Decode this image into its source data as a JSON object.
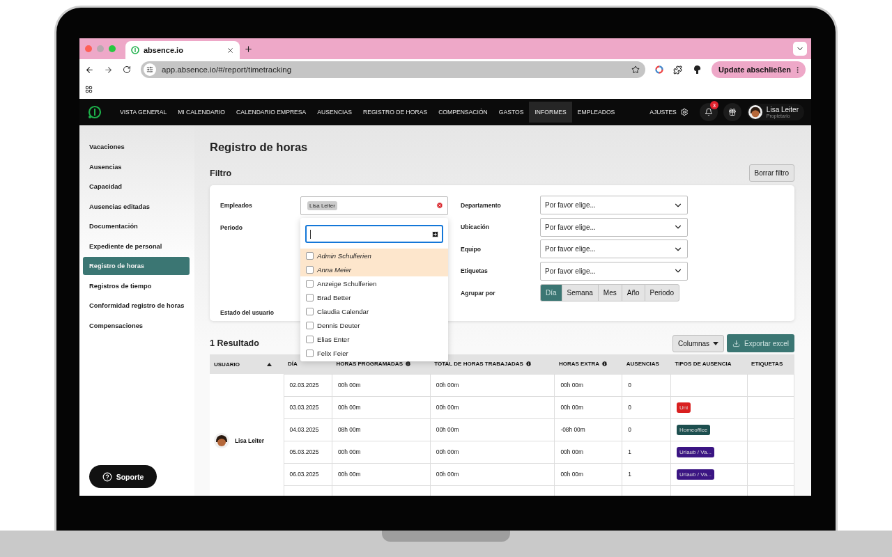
{
  "browser": {
    "tab": {
      "title": "absence.io"
    },
    "url": "app.absence.io/#/report/timetracking",
    "update_button": "Update abschließen"
  },
  "nav": {
    "items": [
      {
        "label": "VISTA GENERAL",
        "selected": false
      },
      {
        "label": "MI CALENDARIO",
        "selected": false
      },
      {
        "label": "CALENDARIO EMPRESA",
        "selected": false
      },
      {
        "label": "AUSENCIAS",
        "selected": false
      },
      {
        "label": "REGISTRO DE HORAS",
        "selected": false
      },
      {
        "label": "COMPENSACIÓN",
        "selected": false
      },
      {
        "label": "GASTOS",
        "selected": false
      },
      {
        "label": "INFORMES",
        "selected": true
      },
      {
        "label": "EMPLEADOS",
        "selected": false
      }
    ],
    "settings": "AJUSTES",
    "notification_count": "3",
    "user": {
      "name": "Lisa Leiter",
      "role": "Propietario"
    }
  },
  "sidebar": {
    "items": [
      {
        "label": "Vacaciones",
        "selected": false
      },
      {
        "label": "Ausencias",
        "selected": false
      },
      {
        "label": "Capacidad",
        "selected": false
      },
      {
        "label": "Ausencias editadas",
        "selected": false
      },
      {
        "label": "Documentación",
        "selected": false
      },
      {
        "label": "Expediente de personal",
        "selected": false
      },
      {
        "label": "Registro de horas",
        "selected": true
      },
      {
        "label": "Registros de tiempo",
        "selected": false
      },
      {
        "label": "Conformidad registro de horas",
        "selected": false
      },
      {
        "label": "Compensaciones",
        "selected": false
      }
    ],
    "support_button": "Soporte"
  },
  "page": {
    "title": "Registro de horas",
    "filter_title": "Filtro",
    "clear_filter": "Borrar filtro"
  },
  "filter": {
    "left": [
      {
        "label": "Empleados"
      },
      {
        "label": "Periodo"
      },
      {
        "label": "Estado del usuario"
      }
    ],
    "employee_chip": "Lisa Leiter",
    "right": [
      {
        "label": "Departamento",
        "placeholder": "Por favor elige..."
      },
      {
        "label": "Ubicación",
        "placeholder": "Por favor elige..."
      },
      {
        "label": "Equipo",
        "placeholder": "Por favor elige..."
      },
      {
        "label": "Etiquetas",
        "placeholder": "Por favor elige..."
      }
    ],
    "group_by": {
      "label": "Agrupar por",
      "options": [
        {
          "label": "Día",
          "selected": true
        },
        {
          "label": "Semana",
          "selected": false
        },
        {
          "label": "Mes",
          "selected": false
        },
        {
          "label": "Año",
          "selected": false
        },
        {
          "label": "Periodo",
          "selected": false
        }
      ]
    }
  },
  "employee_dropdown": {
    "items": [
      {
        "name": "Admin Schulferien",
        "checked": false,
        "highlighted": true
      },
      {
        "name": "Anna Meier",
        "checked": false,
        "highlighted": true
      },
      {
        "name": "Anzeige Schulferien",
        "checked": false,
        "highlighted": false
      },
      {
        "name": "Brad Better",
        "checked": false,
        "highlighted": false
      },
      {
        "name": "Claudia Calendar",
        "checked": false,
        "highlighted": false
      },
      {
        "name": "Dennis Deuter",
        "checked": false,
        "highlighted": false
      },
      {
        "name": "Elias Enter",
        "checked": false,
        "highlighted": false
      },
      {
        "name": "Felix Feier",
        "checked": false,
        "highlighted": false
      }
    ]
  },
  "results": {
    "title": "1 Resultado",
    "columns_button": "Columnas",
    "export_button": "Exportar excel"
  },
  "table": {
    "columns": [
      {
        "label": "USUARIO",
        "info": false,
        "sorted": true
      },
      {
        "label": "DÍA",
        "info": false,
        "sorted": false
      },
      {
        "label": "HORAS PROGRAMADAS",
        "info": true,
        "sorted": false
      },
      {
        "label": "TOTAL DE HORAS TRABAJADAS",
        "info": true,
        "sorted": false
      },
      {
        "label": "HORAS EXTRA",
        "info": true,
        "sorted": false
      },
      {
        "label": "AUSENCIAS",
        "info": false,
        "sorted": false
      },
      {
        "label": "TIPOS DE AUSENCIA",
        "info": false,
        "sorted": false
      },
      {
        "label": "ETIQUETAS",
        "info": false,
        "sorted": false
      }
    ],
    "user": "Lisa Leiter",
    "rows": [
      {
        "day": "02.03.2025",
        "scheduled": "00h 00m",
        "worked": "00h 00m",
        "overtime": "00h 00m",
        "absences": "0",
        "tags": []
      },
      {
        "day": "03.03.2025",
        "scheduled": "00h 00m",
        "worked": "00h 00m",
        "overtime": "00h 00m",
        "absences": "0",
        "tags": [
          {
            "label": "Uni",
            "color": "#d91f1f"
          }
        ]
      },
      {
        "day": "04.03.2025",
        "scheduled": "08h 00m",
        "worked": "00h 00m",
        "overtime": "-08h 00m",
        "absences": "0",
        "tags": [
          {
            "label": "Homeoffice",
            "color": "#1d4f4f"
          }
        ]
      },
      {
        "day": "05.03.2025",
        "scheduled": "00h 00m",
        "worked": "00h 00m",
        "overtime": "00h 00m",
        "absences": "1",
        "tags": [
          {
            "label": "Urlaub / Va...",
            "color": "#3b1583"
          }
        ]
      },
      {
        "day": "06.03.2025",
        "scheduled": "00h 00m",
        "worked": "00h 00m",
        "overtime": "00h 00m",
        "absences": "1",
        "tags": [
          {
            "label": "Urlaub / Va...",
            "color": "#3b1583"
          }
        ]
      }
    ]
  }
}
